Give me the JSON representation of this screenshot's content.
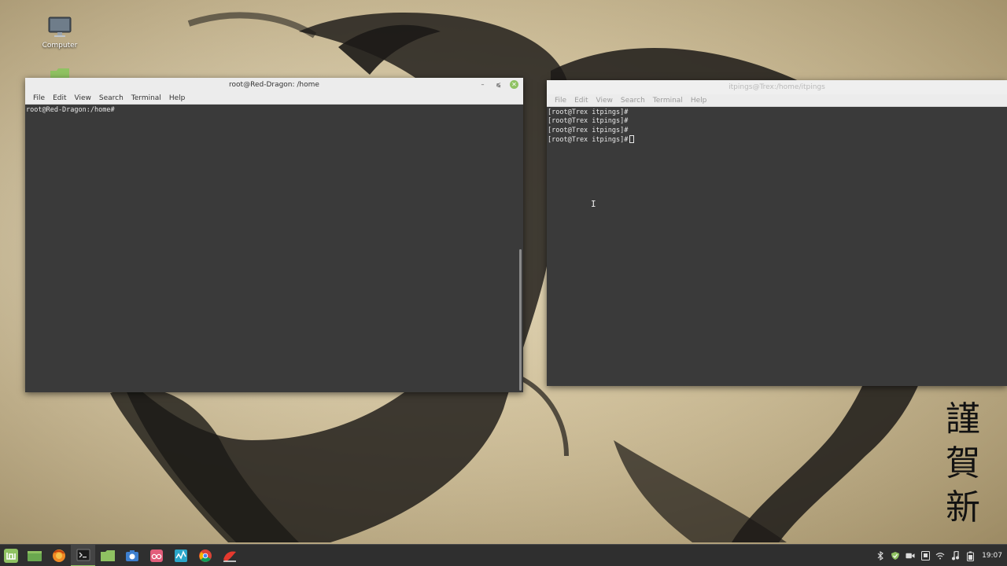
{
  "desktop": {
    "icons": [
      {
        "label": "Computer",
        "icon": "computer-icon"
      },
      {
        "label": "",
        "icon": "folder-icon"
      }
    ],
    "wallpaper_text": [
      "謹",
      "賀",
      "新"
    ]
  },
  "window_left": {
    "title": "root@Red-Dragon: /home",
    "menu": [
      "File",
      "Edit",
      "View",
      "Search",
      "Terminal",
      "Help"
    ],
    "lines": [
      "root@Red-Dragon:/home#"
    ],
    "controls": [
      "minimize-icon",
      "maximize-icon",
      "close-icon"
    ]
  },
  "window_right": {
    "title": "itpings@Trex:/home/itpings",
    "menu": [
      "File",
      "Edit",
      "View",
      "Search",
      "Terminal",
      "Help"
    ],
    "lines": [
      "[root@Trex itpings]#",
      "[root@Trex itpings]#",
      "[root@Trex itpings]#",
      "[root@Trex itpings]#"
    ]
  },
  "taskbar": {
    "apps": [
      {
        "name": "mint-menu-icon",
        "active": false
      },
      {
        "name": "show-desktop-icon",
        "active": false
      },
      {
        "name": "firefox-icon",
        "active": false
      },
      {
        "name": "terminal-icon",
        "active": true
      },
      {
        "name": "files-icon",
        "active": false
      },
      {
        "name": "screenshot-icon",
        "active": false
      },
      {
        "name": "glasses-app-icon",
        "active": false
      },
      {
        "name": "system-monitor-icon",
        "active": false
      },
      {
        "name": "chrome-icon",
        "active": false
      },
      {
        "name": "red-app-icon",
        "active": false
      }
    ],
    "tray_icons": [
      "bluetooth-icon",
      "shield-icon",
      "video-icon",
      "screen-icon",
      "wifi-icon",
      "music-icon",
      "battery-icon"
    ],
    "clock": "19:07"
  },
  "colors": {
    "terminal_bg": "#3a3a3a",
    "titlebar": "#ececec",
    "accent_green": "#8fc262",
    "panel": "#2f2f2f"
  }
}
